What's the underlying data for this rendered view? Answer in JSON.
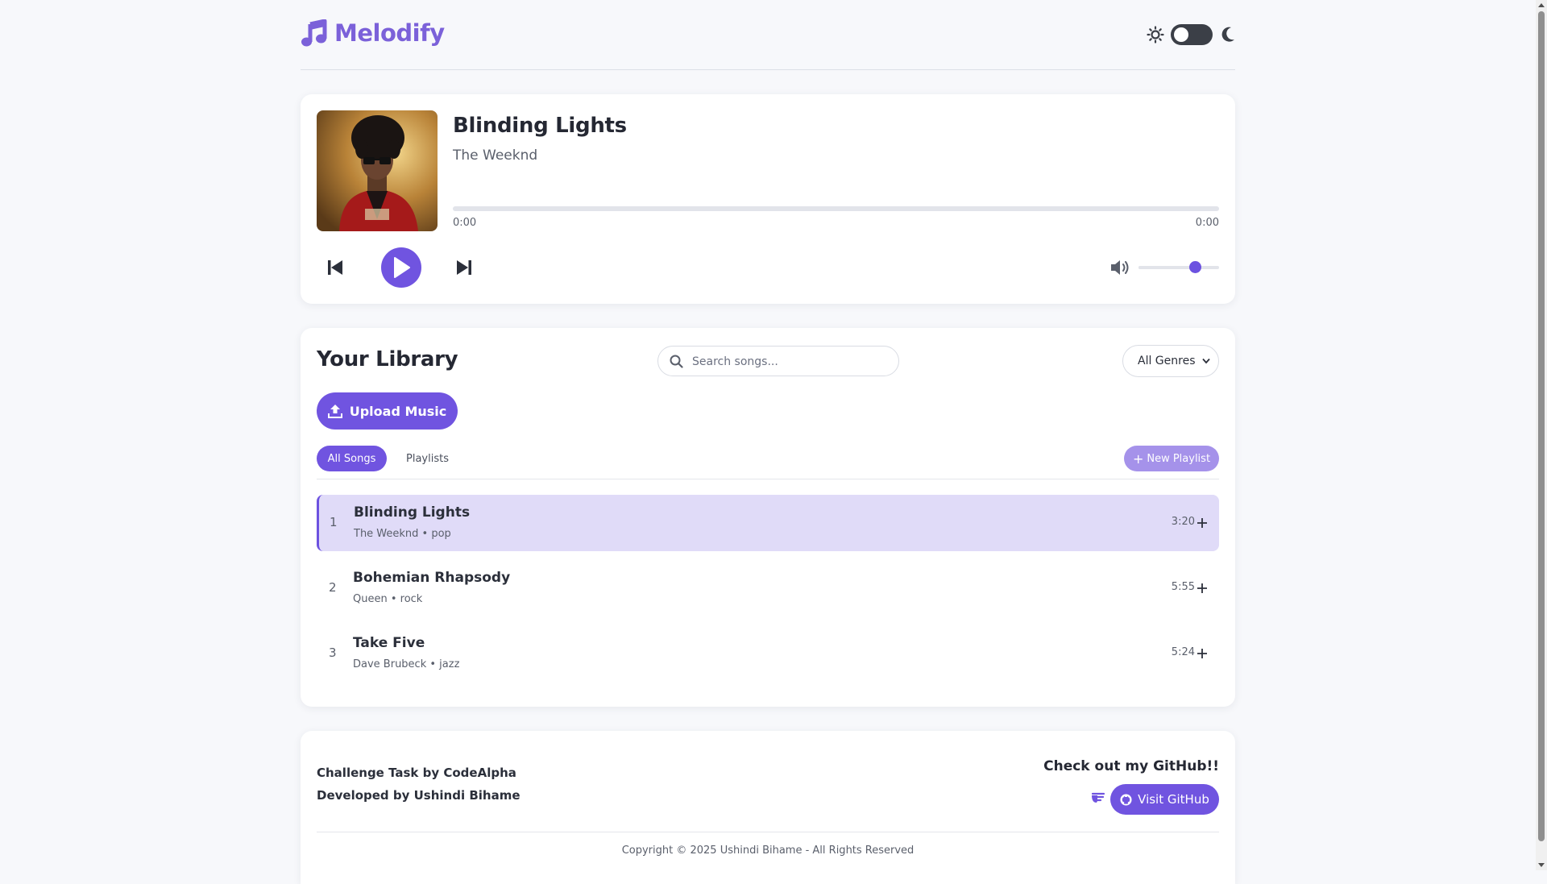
{
  "app": {
    "name": "Melodify"
  },
  "colors": {
    "accent": "#7054e0",
    "brand": "#7b61d9",
    "active_row": "#e0dbf8",
    "new_playlist": "#a592ea"
  },
  "header": {
    "logo_icon": "music-note-icon",
    "theme_toggle": {
      "light_icon": "sun-icon",
      "dark_icon": "moon-icon",
      "dark_mode": false
    }
  },
  "player": {
    "title": "Blinding Lights",
    "artist": "The Weeknd",
    "cover_icon": "album-cover",
    "current_time": "0:00",
    "duration": "0:00",
    "progress": 0,
    "volume": 0.7,
    "controls": {
      "prev_icon": "skip-back-icon",
      "play_icon": "play-icon",
      "next_icon": "skip-forward-icon",
      "volume_icon": "volume-icon"
    }
  },
  "library": {
    "title": "Your Library",
    "search": {
      "placeholder": "Search songs...",
      "value": ""
    },
    "genre_select": {
      "selected": "All Genres"
    },
    "upload_label": "Upload Music",
    "tabs": [
      {
        "label": "All Songs",
        "active": true
      },
      {
        "label": "Playlists",
        "active": false
      }
    ],
    "new_playlist_label": "New Playlist",
    "songs": [
      {
        "index": "1",
        "title": "Blinding Lights",
        "meta": "The Weeknd • pop",
        "duration": "3:20",
        "active": true
      },
      {
        "index": "2",
        "title": "Bohemian Rhapsody",
        "meta": "Queen • rock",
        "duration": "5:55",
        "active": false
      },
      {
        "index": "3",
        "title": "Take Five",
        "meta": "Dave Brubeck • jazz",
        "duration": "5:24",
        "active": false
      }
    ]
  },
  "footer": {
    "line1": "Challenge Task by CodeAlpha",
    "line2": "Developed by Ushindi Bihame",
    "github_title": "Check out my GitHub!!",
    "github_button": "Visit GitHub",
    "copyright": "Copyright © 2025 Ushindi Bihame - All Rights Reserved"
  }
}
